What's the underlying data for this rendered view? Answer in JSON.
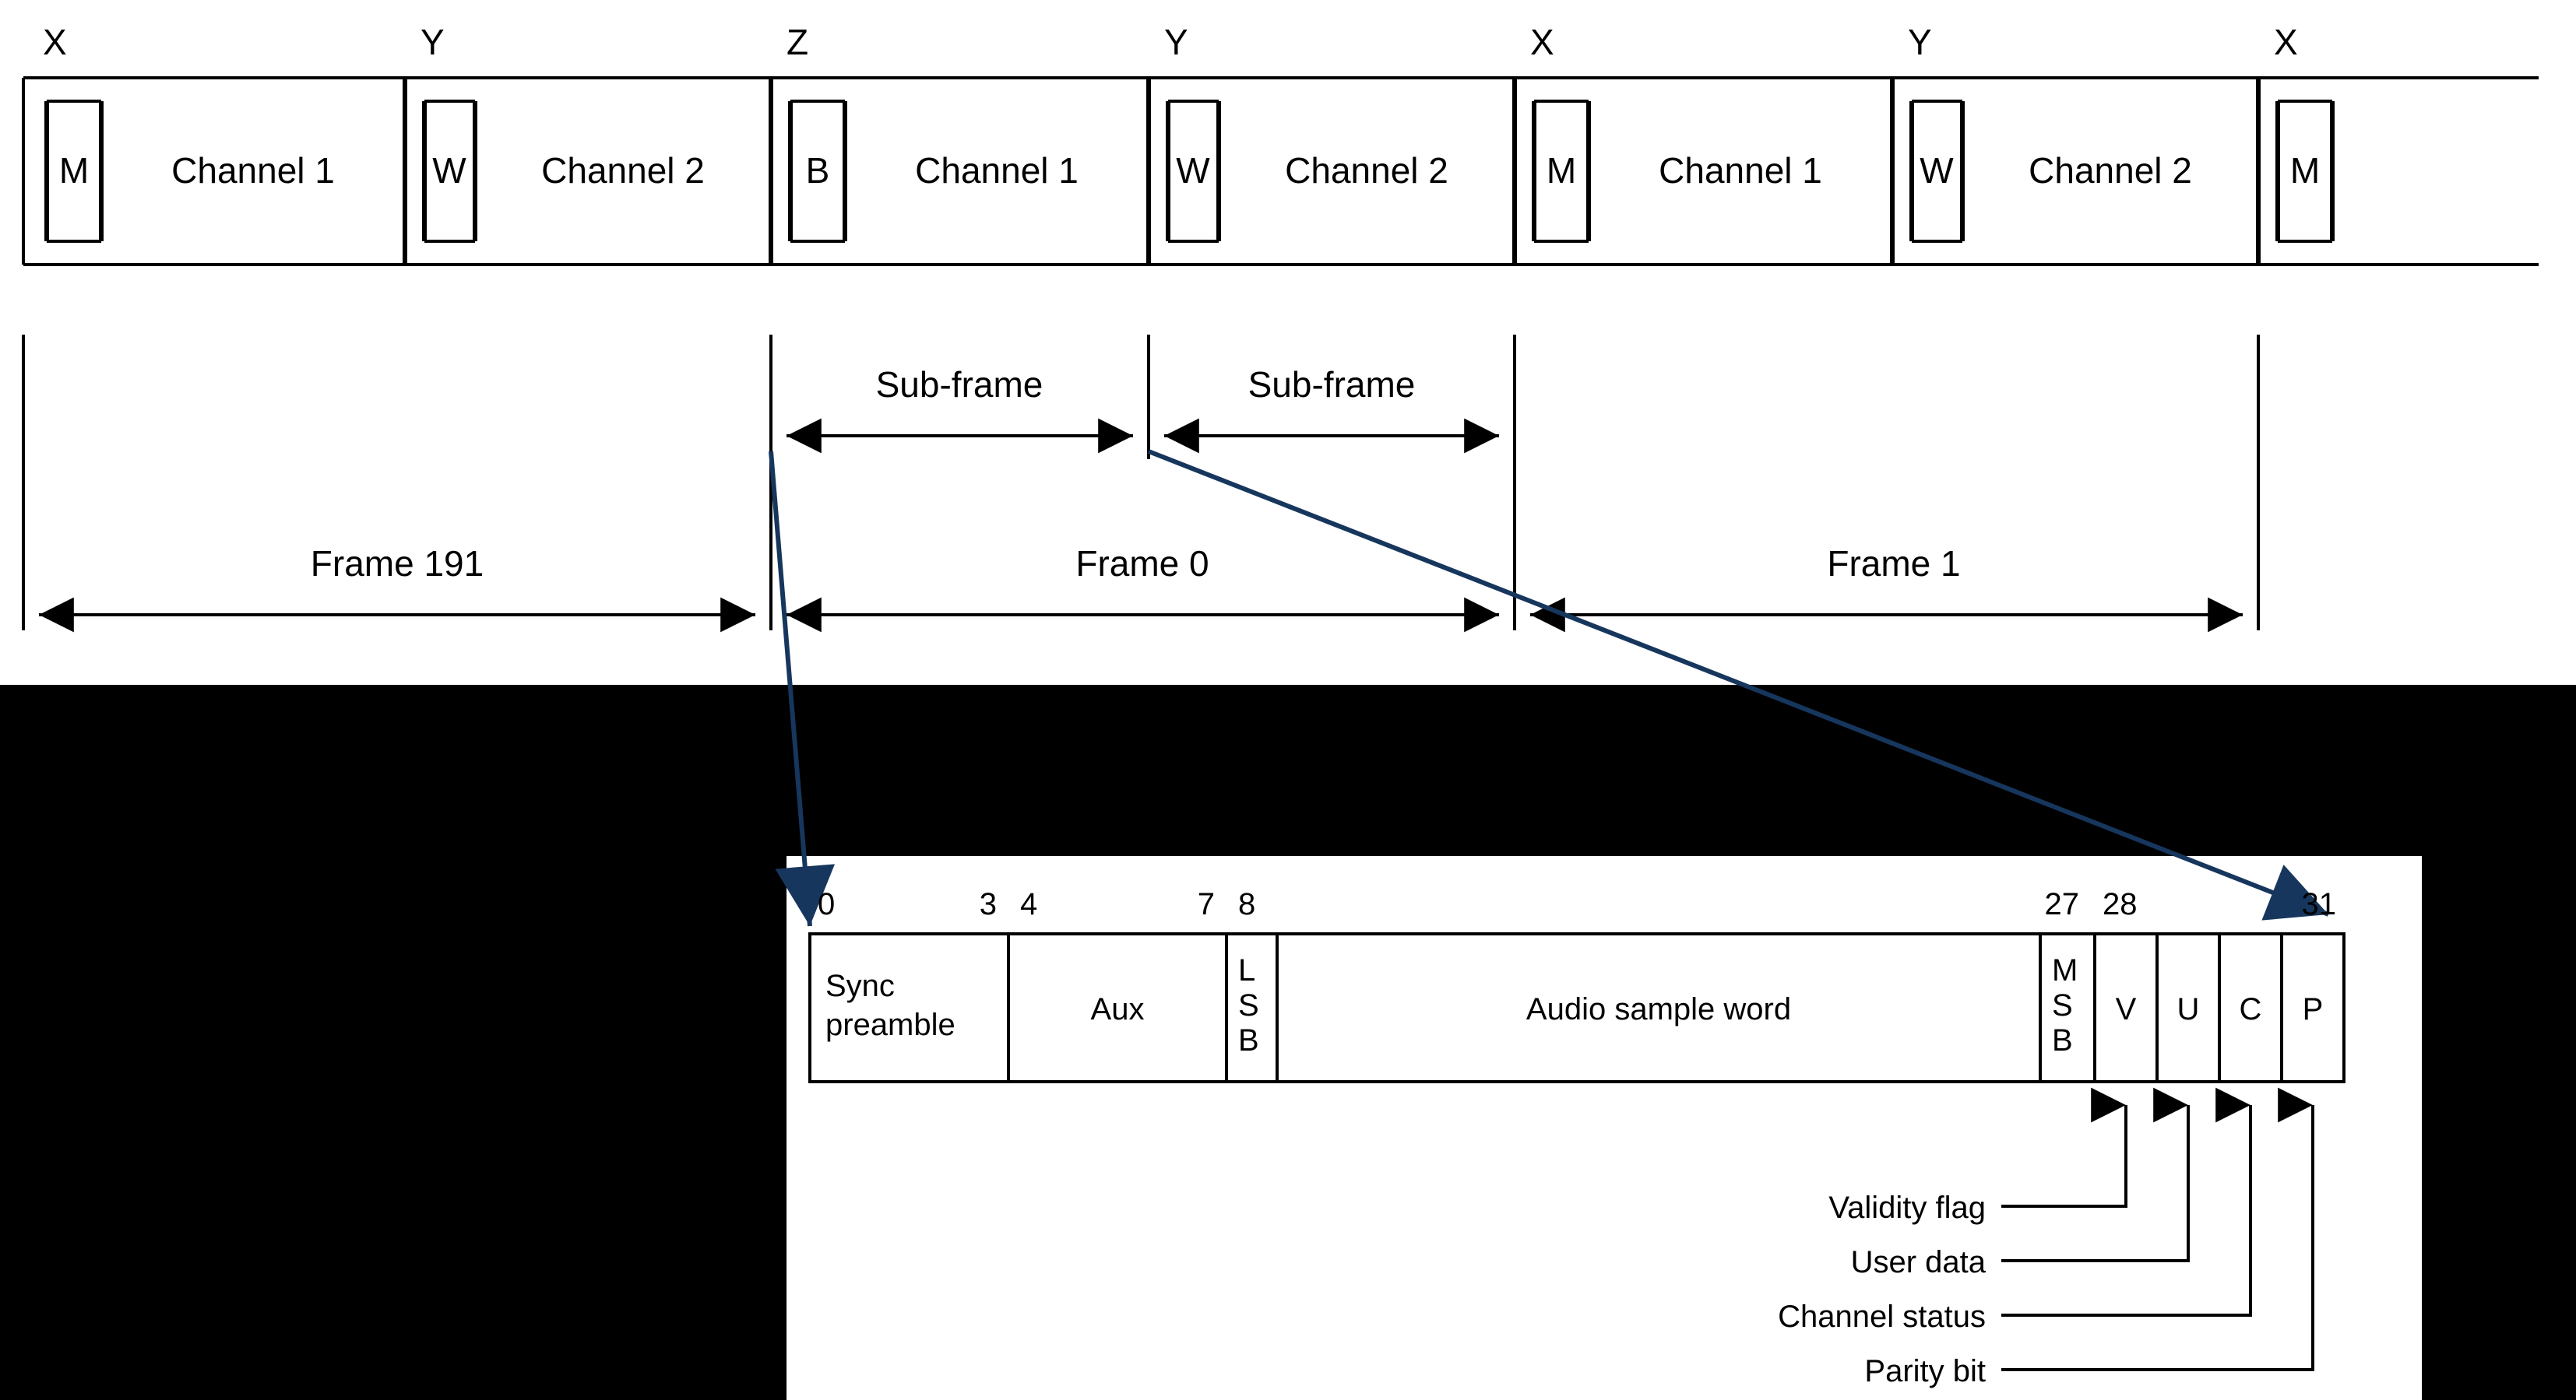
{
  "top": {
    "markers": {
      "m0": "X",
      "m1": "Y",
      "m2": "Z",
      "m3": "Y",
      "m4": "X",
      "m5": "Y",
      "m6": "X"
    },
    "cells": {
      "c0": "M",
      "c1": "Channel 1",
      "c2": "W",
      "c3": "Channel 2",
      "c4": "B",
      "c5": "Channel 1",
      "c6": "W",
      "c7": "Channel 2",
      "c8": "M",
      "c9": "Channel 1",
      "c10": "W",
      "c11": "Channel 2",
      "c12": "M"
    },
    "subframes": {
      "s0": "Sub-frame",
      "s1": "Sub-frame"
    },
    "frames": {
      "f0": "Frame 191",
      "f1": "Frame 0",
      "f2": "Frame 1"
    }
  },
  "detail": {
    "bits": {
      "b0": "0",
      "b3": "3",
      "b4": "4",
      "b7": "7",
      "b8": "8",
      "b27": "27",
      "b28": "28",
      "b31": "31"
    },
    "fields": {
      "sync_l1": "Sync",
      "sync_l2": "preamble",
      "aux": "Aux",
      "lsb_l1": "L",
      "lsb_l2": "S",
      "lsb_l3": "B",
      "audio": "Audio sample word",
      "msb_l1": "M",
      "msb_l2": "S",
      "msb_l3": "B",
      "v": "V",
      "u": "U",
      "c": "C",
      "p": "P"
    },
    "legend": {
      "validity": "Validity flag",
      "user": "User data",
      "channel": "Channel status",
      "parity": "Parity bit"
    }
  }
}
